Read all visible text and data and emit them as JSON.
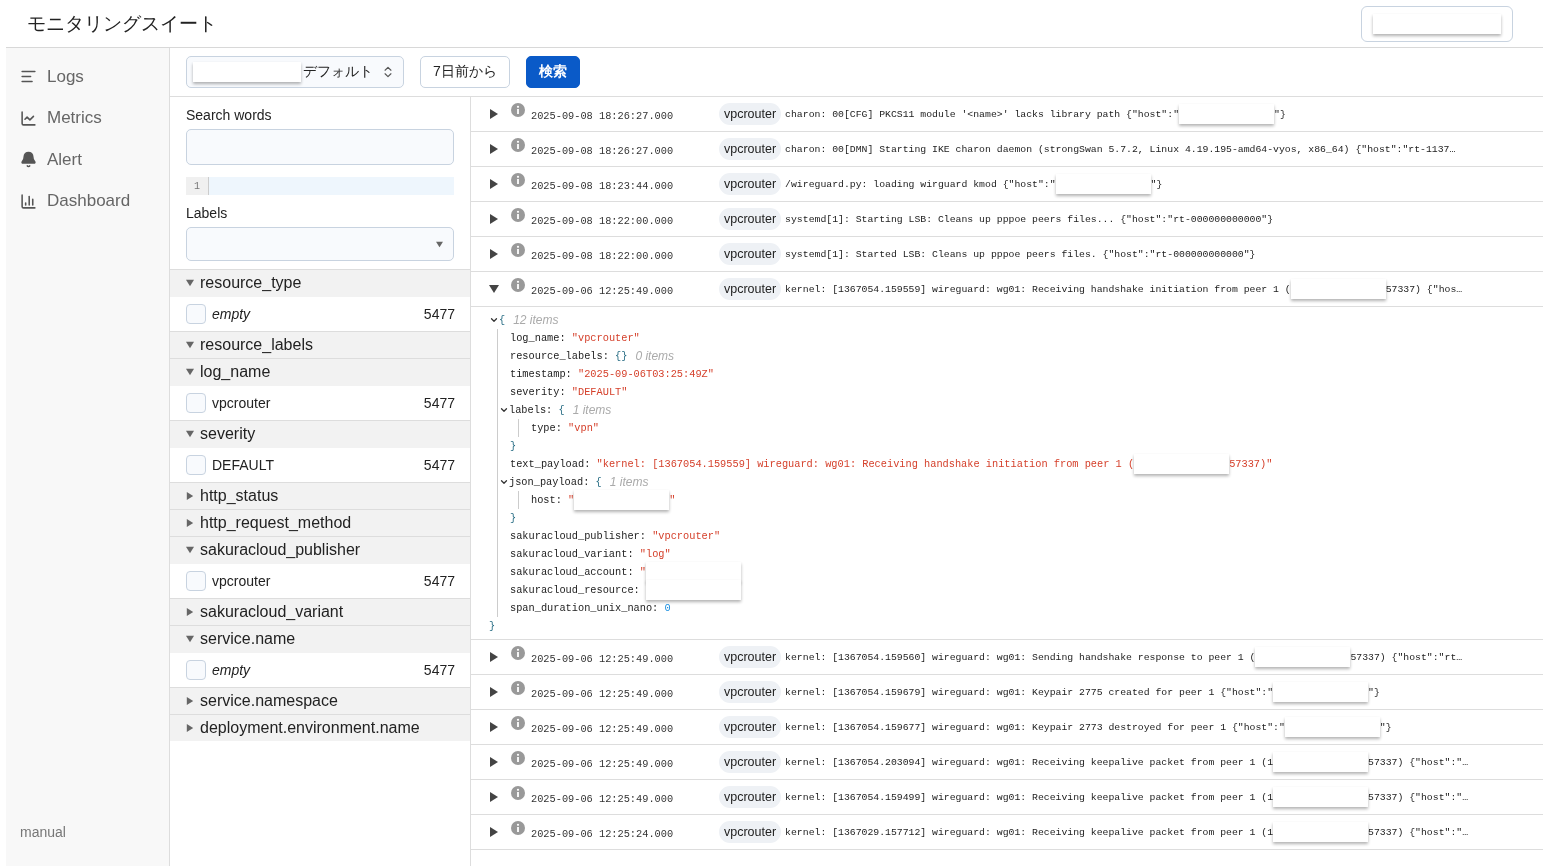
{
  "header": {
    "title": "モニタリングスイート",
    "account_menu": {
      "redacted": true
    }
  },
  "sidebar": {
    "items": [
      {
        "label": "Logs",
        "kind": "logs"
      },
      {
        "label": "Metrics",
        "kind": "metrics"
      },
      {
        "label": "Alert",
        "kind": "alert"
      },
      {
        "label": "Dashboard",
        "kind": "dashboard"
      }
    ],
    "footer": "manual"
  },
  "toolbar": {
    "select": {
      "redacted": true,
      "value": "デフォルト"
    },
    "range_button": "7日前から",
    "search_button": "検索"
  },
  "filters": {
    "search_label": "Search words",
    "search_placeholder_lines": [
      "1"
    ],
    "labels_label": "Labels",
    "facets": [
      {
        "name": "resource_type",
        "expanded": true,
        "values": [
          {
            "label": "empty",
            "kind": "empty",
            "count": "5477",
            "checked": false
          }
        ]
      },
      {
        "name": "resource_labels",
        "expanded": true
      },
      {
        "name": "log_name",
        "expanded": true,
        "values": [
          {
            "label": "vpcrouter",
            "kind": "value",
            "count": "5477",
            "checked": false
          }
        ]
      },
      {
        "name": "severity",
        "expanded": true,
        "values": [
          {
            "label": "DEFAULT",
            "kind": "value",
            "count": "5477",
            "checked": false
          }
        ]
      },
      {
        "name": "http_status",
        "expanded": false
      },
      {
        "name": "http_request_method",
        "expanded": false
      },
      {
        "name": "sakuracloud_publisher",
        "expanded": true,
        "values": [
          {
            "label": "vpcrouter",
            "kind": "value",
            "count": "5477",
            "checked": false
          }
        ]
      },
      {
        "name": "sakuracloud_variant",
        "expanded": false
      },
      {
        "name": "service.name",
        "expanded": true,
        "values": [
          {
            "label": "empty",
            "kind": "empty",
            "count": "5477",
            "checked": false
          }
        ]
      },
      {
        "name": "service.namespace",
        "expanded": false
      },
      {
        "name": "deployment.environment.name",
        "expanded": false
      }
    ]
  },
  "logs": [
    {
      "timestamp": "2025-09-08 18:26:27.000",
      "tag": "vpcrouter",
      "expanded": false,
      "message": [
        {
          "kind": "text",
          "text": "charon: 00[CFG] PKCS11 module '<name>' lacks library path {\"host\":\""
        },
        {
          "kind": "redacted"
        },
        {
          "kind": "text",
          "text": "\"}"
        }
      ]
    },
    {
      "timestamp": "2025-09-08 18:26:27.000",
      "tag": "vpcrouter",
      "expanded": false,
      "message": [
        {
          "kind": "text",
          "text": "charon: 00[DMN] Starting IKE charon daemon (strongSwan 5.7.2, Linux 4.19.195-amd64-vyos, x86_64) {\"host\":\"rt-1137…"
        }
      ]
    },
    {
      "timestamp": "2025-09-08 18:23:44.000",
      "tag": "vpcrouter",
      "expanded": false,
      "message": [
        {
          "kind": "text",
          "text": "/wireguard.py: loading wirguard kmod {\"host\":\""
        },
        {
          "kind": "redacted"
        },
        {
          "kind": "text",
          "text": "\"}"
        }
      ]
    },
    {
      "timestamp": "2025-09-08 18:22:00.000",
      "tag": "vpcrouter",
      "expanded": false,
      "message": [
        {
          "kind": "text",
          "text": "systemd[1]: Starting LSB: Cleans up pppoe peers files... {\"host\":\"rt-000000000000\"}"
        }
      ]
    },
    {
      "timestamp": "2025-09-08 18:22:00.000",
      "tag": "vpcrouter",
      "expanded": false,
      "message": [
        {
          "kind": "text",
          "text": "systemd[1]: Started LSB: Cleans up pppoe peers files. {\"host\":\"rt-000000000000\"}"
        }
      ]
    },
    {
      "timestamp": "2025-09-06 12:25:49.000",
      "tag": "vpcrouter",
      "expanded": true,
      "message": [
        {
          "kind": "text",
          "text": "kernel: [1367054.159559] wireguard: wg01: Receiving handshake initiation from peer 1 ("
        },
        {
          "kind": "redacted"
        },
        {
          "kind": "text",
          "text": "57337) {\"hos…"
        }
      ],
      "detail": {
        "open": "{",
        "count": "12 items",
        "close": "}",
        "entries": [
          {
            "key": "log_name:",
            "kind": "string",
            "value": "\"vpcrouter\""
          },
          {
            "key": "resource_labels:",
            "kind": "empty",
            "value": "{}",
            "count": "0 items"
          },
          {
            "key": "timestamp:",
            "kind": "string",
            "value": "\"2025-09-06T03:25:49Z\""
          },
          {
            "key": "severity:",
            "kind": "string",
            "value": "\"DEFAULT\""
          },
          {
            "key": "labels:",
            "kind": "object",
            "open": "{",
            "count": "1 items",
            "close": "}",
            "children": [
              {
                "key": "type:",
                "kind": "string",
                "value": "\"vpn\""
              }
            ]
          },
          {
            "key": "text_payload:",
            "kind": "string",
            "value_parts": [
              {
                "kind": "text",
                "text": "\"kernel: [1367054.159559] wireguard: wg01: Receiving handshake initiation from peer 1 ("
              },
              {
                "kind": "redacted"
              },
              {
                "kind": "text",
                "text": "57337)\""
              }
            ]
          },
          {
            "key": "json_payload:",
            "kind": "object",
            "open": "{",
            "count": "1 items",
            "close": "}",
            "children": [
              {
                "key": "host:",
                "kind": "string",
                "value_parts": [
                  {
                    "kind": "text",
                    "text": "\""
                  },
                  {
                    "kind": "redacted"
                  },
                  {
                    "kind": "text",
                    "text": "\""
                  }
                ]
              }
            ]
          },
          {
            "key": "sakuracloud_publisher:",
            "kind": "string",
            "value": "\"vpcrouter\""
          },
          {
            "key": "sakuracloud_variant:",
            "kind": "string",
            "value": "\"log\""
          },
          {
            "key": "sakuracloud_account:",
            "kind": "string",
            "value_parts": [
              {
                "kind": "text",
                "text": "\""
              },
              {
                "kind": "redacted"
              }
            ]
          },
          {
            "key": "sakuracloud_resource:",
            "kind": "string",
            "value_parts": [
              {
                "kind": "redacted"
              }
            ]
          },
          {
            "key": "span_duration_unix_nano:",
            "kind": "number",
            "value": "0"
          }
        ]
      }
    },
    {
      "timestamp": "2025-09-06 12:25:49.000",
      "tag": "vpcrouter",
      "expanded": false,
      "message": [
        {
          "kind": "text",
          "text": "kernel: [1367054.159560] wireguard: wg01: Sending handshake response to peer 1 ("
        },
        {
          "kind": "redacted"
        },
        {
          "kind": "text",
          "text": "57337) {\"host\":\"rt…"
        }
      ]
    },
    {
      "timestamp": "2025-09-06 12:25:49.000",
      "tag": "vpcrouter",
      "expanded": false,
      "message": [
        {
          "kind": "text",
          "text": "kernel: [1367054.159679] wireguard: wg01: Keypair 2775 created for peer 1 {\"host\":\""
        },
        {
          "kind": "redacted"
        },
        {
          "kind": "text",
          "text": "\"}"
        }
      ]
    },
    {
      "timestamp": "2025-09-06 12:25:49.000",
      "tag": "vpcrouter",
      "expanded": false,
      "message": [
        {
          "kind": "text",
          "text": "kernel: [1367054.159677] wireguard: wg01: Keypair 2773 destroyed for peer 1 {\"host\":\""
        },
        {
          "kind": "redacted"
        },
        {
          "kind": "text",
          "text": "\"}"
        }
      ]
    },
    {
      "timestamp": "2025-09-06 12:25:49.000",
      "tag": "vpcrouter",
      "expanded": false,
      "message": [
        {
          "kind": "text",
          "text": "kernel: [1367054.203094] wireguard: wg01: Receiving keepalive packet from peer 1 (1"
        },
        {
          "kind": "redacted"
        },
        {
          "kind": "text",
          "text": "57337) {\"host\":\"…"
        }
      ]
    },
    {
      "timestamp": "2025-09-06 12:25:49.000",
      "tag": "vpcrouter",
      "expanded": false,
      "message": [
        {
          "kind": "text",
          "text": "kernel: [1367054.159499] wireguard: wg01: Receiving keepalive packet from peer 1 (1"
        },
        {
          "kind": "redacted"
        },
        {
          "kind": "text",
          "text": "57337) {\"host\":\"…"
        }
      ]
    },
    {
      "timestamp": "2025-09-06 12:25:24.000",
      "tag": "vpcrouter",
      "expanded": false,
      "message": [
        {
          "kind": "text",
          "text": "kernel: [1367029.157712] wireguard: wg01: Receiving keepalive packet from peer 1 (1"
        },
        {
          "kind": "redacted"
        },
        {
          "kind": "text",
          "text": "57337) {\"host\":\"…"
        }
      ]
    }
  ]
}
